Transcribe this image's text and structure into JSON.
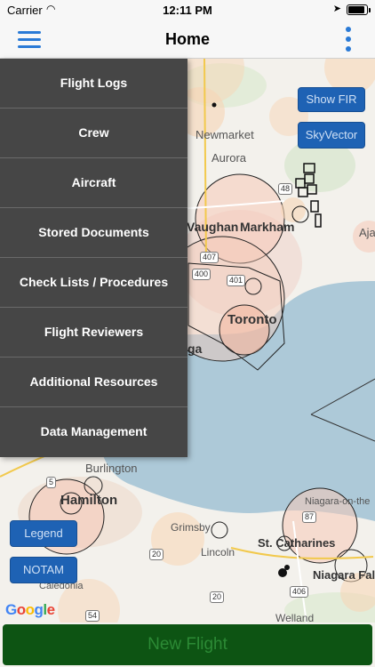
{
  "status_bar": {
    "carrier": "Carrier",
    "time": "12:11 PM"
  },
  "nav": {
    "title": "Home"
  },
  "menu": {
    "items": [
      {
        "label": "Flight Logs"
      },
      {
        "label": "Crew"
      },
      {
        "label": "Aircraft"
      },
      {
        "label": "Stored Documents"
      },
      {
        "label": "Check Lists / Procedures"
      },
      {
        "label": "Flight Reviewers"
      },
      {
        "label": "Additional Resources"
      },
      {
        "label": "Data Management"
      }
    ]
  },
  "map": {
    "buttons": {
      "show_fir": "Show FIR",
      "skyvector": "SkyVector",
      "legend": "Legend",
      "notam": "NOTAM"
    },
    "labels": {
      "newmarket": "Newmarket",
      "aurora": "Aurora",
      "vaughan": "Vaughan",
      "markham": "Markham",
      "toronto": "Toronto",
      "ga": "ga",
      "aja": "Aja",
      "burlington": "Burlington",
      "hamilton": "Hamilton",
      "grimsby": "Grimsby",
      "lincoln": "Lincoln",
      "st_catharines": "St. Catharines",
      "niagara_on_the": "Niagara-on-the",
      "niagara_falls": "Niagara Fall",
      "caledonia": "Caledonia",
      "welland": "Welland"
    },
    "road_shields": {
      "r48": "48",
      "r407": "407",
      "r400": "400",
      "r401": "401",
      "r5": "5",
      "r20a": "20",
      "r20b": "20",
      "r87": "87",
      "r406": "406",
      "r54": "54"
    },
    "attribution": "Google"
  },
  "footer": {
    "new_flight": "New Flight"
  },
  "colors": {
    "accent": "#2a7ad6",
    "drawer_bg": "#464646",
    "map_button": "#1e62b4",
    "new_flight_bg": "#0d5413"
  }
}
